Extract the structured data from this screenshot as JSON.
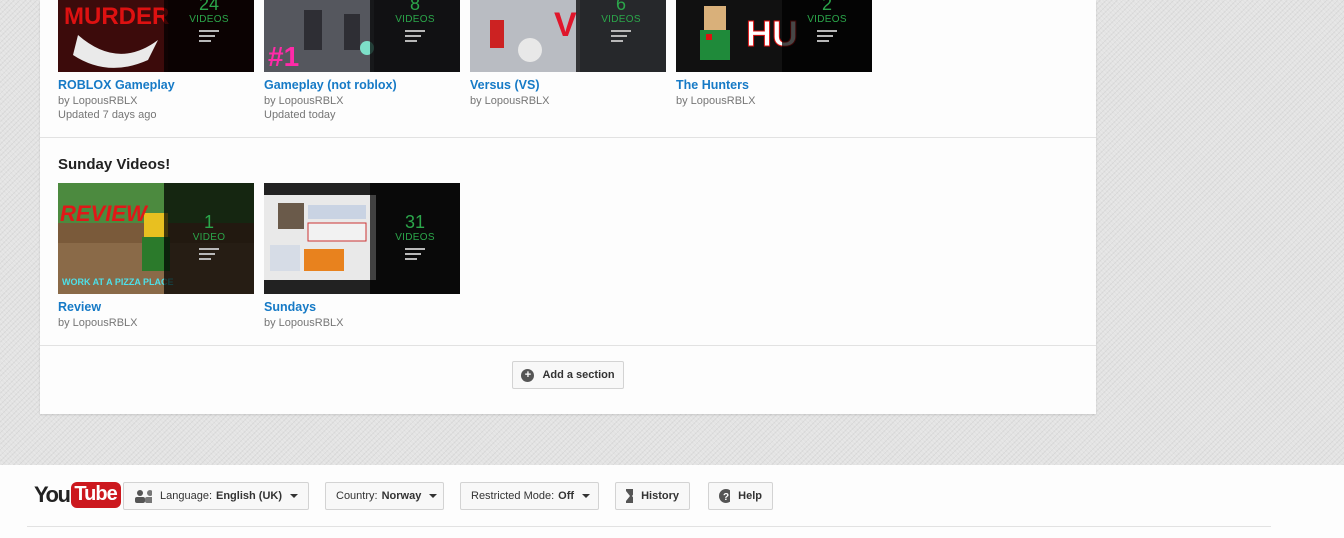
{
  "shelves": [
    {
      "title": "",
      "playlists": [
        {
          "title": "ROBLOX Gameplay",
          "byline": "by LopousRBLX",
          "updated": "Updated 7 days ago",
          "count": "24",
          "unit": "VIDEOS",
          "thumb_text": "MURDER"
        },
        {
          "title": "Gameplay (not roblox)",
          "byline": "by LopousRBLX",
          "updated": "Updated today",
          "count": "8",
          "unit": "VIDEOS",
          "thumb_text": "#1"
        },
        {
          "title": "Versus (VS)",
          "byline": "by LopousRBLX",
          "updated": "",
          "count": "6",
          "unit": "VIDEOS",
          "thumb_text": "V"
        },
        {
          "title": "The Hunters",
          "byline": "by LopousRBLX",
          "updated": "",
          "count": "2",
          "unit": "VIDEOS",
          "thumb_text": "HU"
        }
      ]
    },
    {
      "title": "Sunday Videos!",
      "playlists": [
        {
          "title": "Review",
          "byline": "by LopousRBLX",
          "count": "1",
          "unit": "VIDEO",
          "thumb_text": "REVIEW",
          "thumb_caption": "WORK AT A PIZZA PLACE"
        },
        {
          "title": "Sundays",
          "byline": "by LopousRBLX",
          "count": "31",
          "unit": "VIDEOS"
        }
      ]
    }
  ],
  "add_section_label": "Add a section",
  "footer": {
    "logo_you": "You",
    "logo_tube": "Tube",
    "language_label": "Language:",
    "language_value": "English (UK)",
    "country_label": "Country:",
    "country_value": "Norway",
    "restricted_label": "Restricted Mode:",
    "restricted_value": "Off",
    "history_label": "History",
    "help_label": "Help"
  },
  "icons": {
    "add": "plus-circle-icon",
    "language": "people-icon",
    "history": "hourglass-icon",
    "help": "question-icon",
    "playlist": "playlist-icon"
  },
  "colors": {
    "link": "#167ac6",
    "count": "#2ba64a",
    "logo_red": "#cc181e"
  }
}
